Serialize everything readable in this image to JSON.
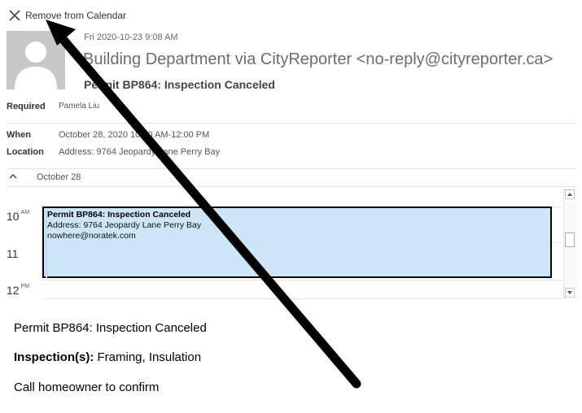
{
  "toolbar": {
    "remove_label": "Remove from Calendar"
  },
  "header": {
    "datetime": "Fri 2020-10-23 9:08 AM",
    "sender": "Building Department via CityReporter <no-reply@cityreporter.ca>",
    "subject": "Permit BP864: Inspection Canceled"
  },
  "attendees": {
    "label": "Required",
    "value": "Pamela Liu"
  },
  "details": {
    "when_label": "When",
    "when_value": "October 28, 2020 10:00 AM-12:00 PM",
    "location_label": "Location",
    "location_value": "Address: 9764 Jeopardy Lane Perry Bay"
  },
  "calendar": {
    "date": "October 28",
    "hours": [
      {
        "num": "10",
        "suffix": "AM"
      },
      {
        "num": "11",
        "suffix": ""
      },
      {
        "num": "12",
        "suffix": "PM"
      }
    ],
    "event": {
      "title": "Permit BP864: Inspection Canceled",
      "address": "Address: 9764 Jeopardy Lane Perry Bay",
      "email": "nowhere@noratek.com",
      "color": "#cde6f7"
    }
  },
  "body": {
    "line1": "Permit BP864: Inspection Canceled",
    "inspections_label": "Inspection(s):",
    "inspections_value": " Framing, Insulation",
    "line3": "Call homeowner to confirm"
  },
  "colors": {
    "annotation_arrow": "#000000",
    "event_fill": "#cde6f7",
    "avatar_bg": "#c8c8c8"
  },
  "icons": {
    "remove": "close-icon",
    "avatar": "person-icon",
    "collapse": "chevron-up-icon",
    "scroll_up": "triangle-up-icon",
    "scroll_down": "triangle-down-icon"
  }
}
